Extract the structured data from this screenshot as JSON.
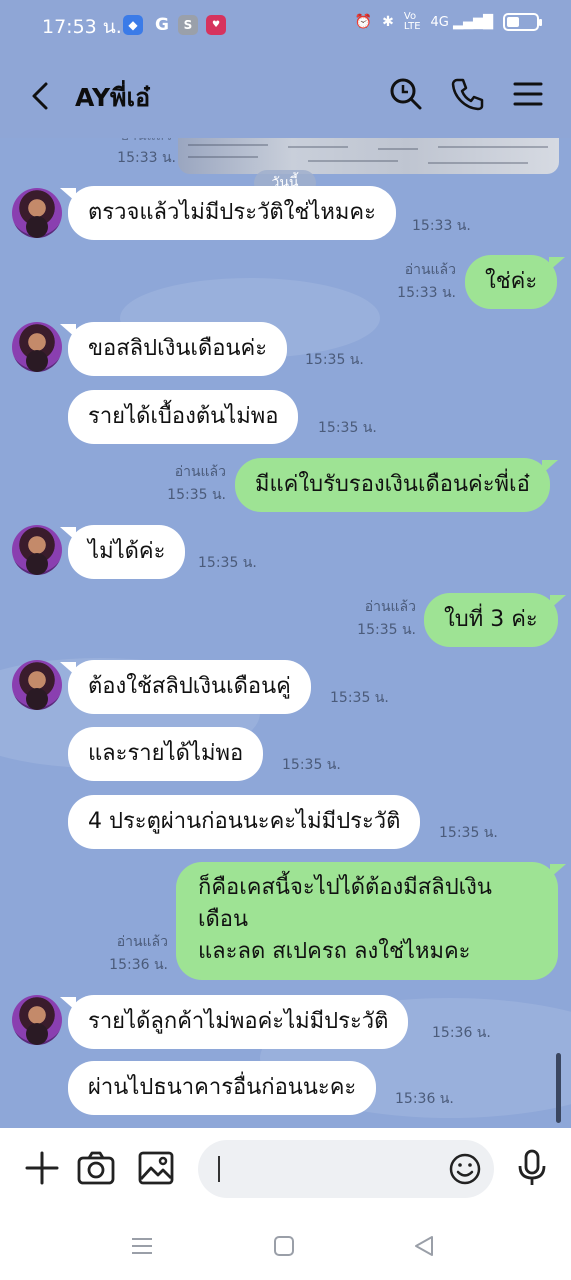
{
  "status_bar": {
    "time": "17:53 น.",
    "apps": [
      "G",
      "S"
    ],
    "network": "4G"
  },
  "header": {
    "contact_name": "AYพี่เอ๋"
  },
  "top_partial": {
    "time": "15:33 น.",
    "read_label": "อ่านแล้ว"
  },
  "date_chip": "วันนี้",
  "messages": [
    {
      "side": "in",
      "text": "ตรวจแล้วไม่มีประวัติใช่ไหมคะ",
      "time": "15:33 น."
    },
    {
      "side": "out",
      "text": "ใช่ค่ะ",
      "time": "15:33 น.",
      "read": "อ่านแล้ว"
    },
    {
      "side": "in",
      "text": "ขอสลิปเงินเดือนค่ะ",
      "time": "15:35 น."
    },
    {
      "side": "in",
      "text": "รายได้เบื้องต้นไม่พอ",
      "time": "15:35 น."
    },
    {
      "side": "out",
      "text": "มีแค่ใบรับรองเงินเดือนค่ะพี่เอ๋",
      "time": "15:35 น.",
      "read": "อ่านแล้ว"
    },
    {
      "side": "in",
      "text": "ไม่ได้ค่ะ",
      "time": "15:35 น."
    },
    {
      "side": "out",
      "text": "ใบที่ 3 ค่ะ",
      "time": "15:35 น.",
      "read": "อ่านแล้ว"
    },
    {
      "side": "in",
      "text": "ต้องใช้สลิปเงินเดือนคู่",
      "time": "15:35 น."
    },
    {
      "side": "in",
      "text": "และรายได้ไม่พอ",
      "time": "15:35 น."
    },
    {
      "side": "in",
      "text": "4 ประตูผ่านก่อนนะคะไม่มีประวัติ",
      "time": "15:35 น."
    },
    {
      "side": "out",
      "lines": [
        "ก็คือเคสนี้จะไปได้ต้องมีสลิปเงิน",
        "เดือน",
        "และลด สเปครถ ลงใช่ไหมคะ"
      ],
      "time": "15:36 น.",
      "read": "อ่านแล้ว"
    },
    {
      "side": "in",
      "text": "รายได้ลูกค้าไม่พอค่ะไม่มีประวัติ",
      "time": "15:36 น."
    },
    {
      "side": "in",
      "text": "ผ่านไปธนาคารอื่นก่อนนะคะ",
      "time": "15:36 น."
    }
  ],
  "icons": {
    "header": [
      "back-arrow-icon",
      "search-icon",
      "phone-icon",
      "menu-icon"
    ],
    "input_bar": [
      "plus-icon",
      "camera-icon",
      "image-icon",
      "emoji-icon",
      "microphone-icon"
    ],
    "nav": [
      "recents-icon",
      "home-icon",
      "back-icon"
    ]
  },
  "colors": {
    "header_bg": "#8fa6d6",
    "chat_bg": "#8ea7d8",
    "incoming_bubble": "#ffffff",
    "outgoing_bubble": "#9ee394"
  }
}
